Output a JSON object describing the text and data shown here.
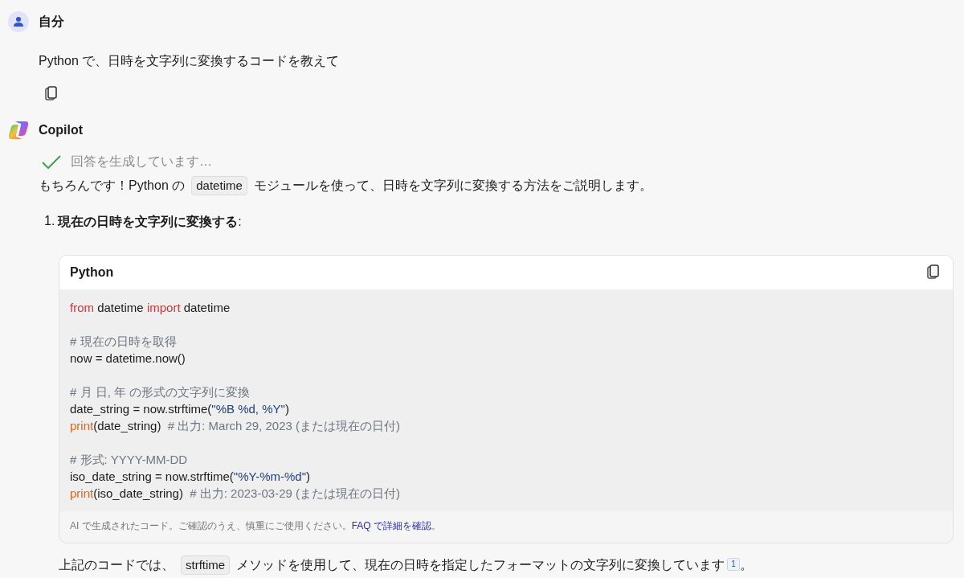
{
  "user": {
    "name": "自分",
    "message": "Python で、日時を文字列に変換するコードを教えて"
  },
  "assistant": {
    "name": "Copilot",
    "status": {
      "text": "回答を生成しています…",
      "done": true
    },
    "intro": [
      {
        "kind": "text",
        "text": "もちろんです！Python の"
      },
      {
        "kind": "code",
        "text": "datetime"
      },
      {
        "kind": "text",
        "text": "モジュールを使って、日時を文字列に変換する方法をご説明します。"
      }
    ],
    "steps": [
      {
        "number": "1.",
        "title": "現在の日時を文字列に変換する",
        "suffix": ":"
      }
    ],
    "code_block": {
      "language": "Python",
      "lines": [
        {
          "kind": "code",
          "tokens": [
            {
              "kind": "keyword",
              "text": "from"
            },
            {
              "kind": "plain",
              "text": " datetime "
            },
            {
              "kind": "keyword",
              "text": "import"
            },
            {
              "kind": "plain",
              "text": " datetime"
            }
          ]
        },
        {
          "kind": "blank"
        },
        {
          "kind": "code",
          "tokens": [
            {
              "kind": "comment",
              "text": "# 現在の日時を取得"
            }
          ]
        },
        {
          "kind": "code",
          "tokens": [
            {
              "kind": "plain",
              "text": "now = datetime.now()"
            }
          ]
        },
        {
          "kind": "blank"
        },
        {
          "kind": "code",
          "tokens": [
            {
              "kind": "comment",
              "text": "# 月 日, 年 の形式の文字列に変換"
            }
          ]
        },
        {
          "kind": "code",
          "tokens": [
            {
              "kind": "plain",
              "text": "date_string = now.strftime("
            },
            {
              "kind": "string",
              "text": "\"%B %d, %Y\""
            },
            {
              "kind": "plain",
              "text": ")"
            }
          ]
        },
        {
          "kind": "code",
          "tokens": [
            {
              "kind": "builtin",
              "text": "print"
            },
            {
              "kind": "plain",
              "text": "(date_string)  "
            },
            {
              "kind": "comment",
              "text": "# 出力: March 29, 2023 (または現在の日付)"
            }
          ]
        },
        {
          "kind": "blank"
        },
        {
          "kind": "code",
          "tokens": [
            {
              "kind": "comment",
              "text": "# 形式: YYYY-MM-DD"
            }
          ]
        },
        {
          "kind": "code",
          "tokens": [
            {
              "kind": "plain",
              "text": "iso_date_string = now.strftime("
            },
            {
              "kind": "string",
              "text": "\"%Y-%m-%d\""
            },
            {
              "kind": "plain",
              "text": ")"
            }
          ]
        },
        {
          "kind": "code",
          "tokens": [
            {
              "kind": "builtin",
              "text": "print"
            },
            {
              "kind": "plain",
              "text": "(iso_date_string)  "
            },
            {
              "kind": "comment",
              "text": "# 出力: 2023-03-29 (または現在の日付)"
            }
          ]
        }
      ],
      "disclaimer": "AI で生成されたコード。ご確認のうえ、慎重にご使用ください。",
      "disclaimer_link": "FAQ で詳細を確認",
      "disclaimer_end": "。"
    },
    "outro": [
      {
        "kind": "text",
        "text": "上記のコードでは、"
      },
      {
        "kind": "code",
        "text": "strftime"
      },
      {
        "kind": "text",
        "text": "メソッドを使用して、現在の日時を指定したフォーマットの文字列に変換しています"
      },
      {
        "kind": "citation",
        "text": "1"
      },
      {
        "kind": "text",
        "text": "。"
      }
    ]
  }
}
